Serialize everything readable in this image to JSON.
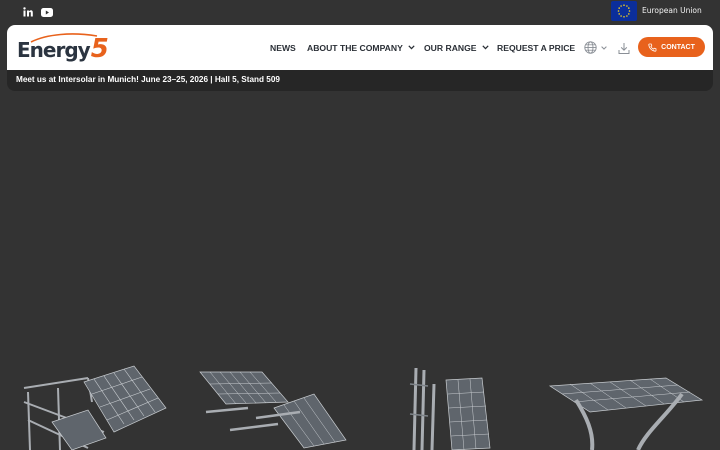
{
  "topbar": {
    "social": [
      {
        "name": "linkedin-icon",
        "glyph": "in"
      },
      {
        "name": "youtube-icon",
        "glyph": "▶"
      }
    ],
    "region": {
      "label": "European Union",
      "flag_color": "#0b2e9b",
      "star_color": "#f7d21b"
    }
  },
  "header": {
    "logo": {
      "text": "Energy",
      "number": "5",
      "text_color": "#2b3440",
      "accent_color": "#e8621c"
    },
    "nav": [
      {
        "label": "NEWS",
        "has_dropdown": false
      },
      {
        "label": "ABOUT THE COMPANY",
        "has_dropdown": true
      },
      {
        "label": "OUR RANGE",
        "has_dropdown": true
      },
      {
        "label": "REQUEST A PRICE",
        "has_dropdown": false
      }
    ],
    "language_icon": "globe-icon",
    "download_icon": "download-icon",
    "contact_label": "CONTACT",
    "contact_color": "#e8621c"
  },
  "announcement": {
    "text": "Meet us at Intersolar in Munich! June 23–25, 2026 | Hall 5, Stand 509"
  },
  "products": [
    {
      "name": "ground-mount-system"
    },
    {
      "name": "flat-roof-system"
    },
    {
      "name": "vertical-fence-system"
    },
    {
      "name": "carport-system"
    }
  ]
}
